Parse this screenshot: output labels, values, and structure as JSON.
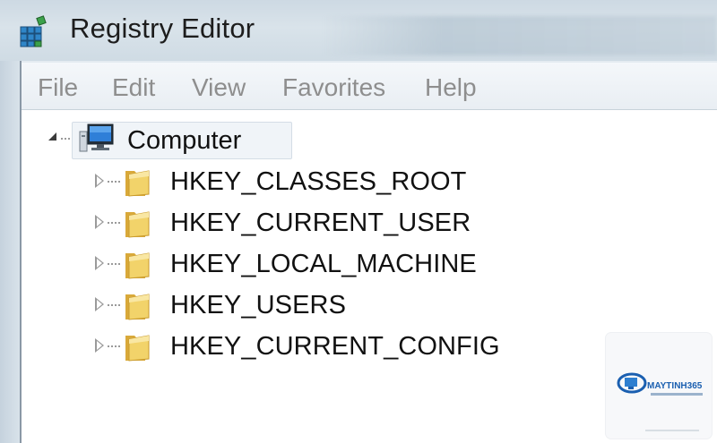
{
  "window": {
    "title": "Registry Editor",
    "app_icon": "registry-editor-icon"
  },
  "menu": [
    "File",
    "Edit",
    "View",
    "Favorites",
    "Help"
  ],
  "tree": {
    "root": {
      "label": "Computer",
      "icon": "computer-icon",
      "expanded": true
    },
    "keys": [
      {
        "label": "HKEY_CLASSES_ROOT",
        "icon": "folder-icon"
      },
      {
        "label": "HKEY_CURRENT_USER",
        "icon": "folder-icon"
      },
      {
        "label": "HKEY_LOCAL_MACHINE",
        "icon": "folder-icon"
      },
      {
        "label": "HKEY_USERS",
        "icon": "folder-icon"
      },
      {
        "label": "HKEY_CURRENT_CONFIG",
        "icon": "folder-icon"
      }
    ]
  },
  "watermark": {
    "brand": "MAYTINH365"
  },
  "colors": {
    "folder": "#e8c24a",
    "menu_text": "#8e8e8e",
    "selection": "#f0f4f8"
  }
}
